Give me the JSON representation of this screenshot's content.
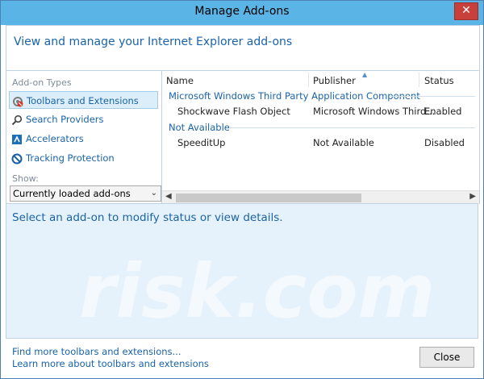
{
  "window": {
    "title": "Manage Add-ons",
    "close_glyph": "✕"
  },
  "header": {
    "text": "View and manage your Internet Explorer add-ons"
  },
  "sidebar": {
    "heading": "Add-on Types",
    "items": [
      {
        "label": "Toolbars and Extensions",
        "icon": "gear-icon",
        "selected": true
      },
      {
        "label": "Search Providers",
        "icon": "search-icon",
        "selected": false
      },
      {
        "label": "Accelerators",
        "icon": "accelerator-icon",
        "selected": false
      },
      {
        "label": "Tracking Protection",
        "icon": "block-icon",
        "selected": false
      }
    ],
    "show_label": "Show:",
    "show_value": "Currently loaded add-ons"
  },
  "list": {
    "columns": [
      "Name",
      "Publisher",
      "Status"
    ],
    "groups": [
      {
        "name": "Microsoft Windows Third Party Application Component",
        "rows": [
          {
            "name": "Shockwave Flash Object",
            "publisher": "Microsoft Windows Third...",
            "status": "Enabled"
          }
        ]
      },
      {
        "name": "Not Available",
        "rows": [
          {
            "name": "SpeeditUp",
            "publisher": "Not Available",
            "status": "Disabled"
          }
        ]
      }
    ]
  },
  "details": {
    "text": "Select an add-on to modify status or view details.",
    "watermark": "risk.com"
  },
  "footer": {
    "link1": "Find more toolbars and extensions...",
    "link2": "Learn more about toolbars and extensions",
    "close_label": "Close"
  },
  "colors": {
    "titlebar": "#5bb4e6",
    "link": "#1a63a8",
    "details_bg": "#e6f2fb"
  }
}
